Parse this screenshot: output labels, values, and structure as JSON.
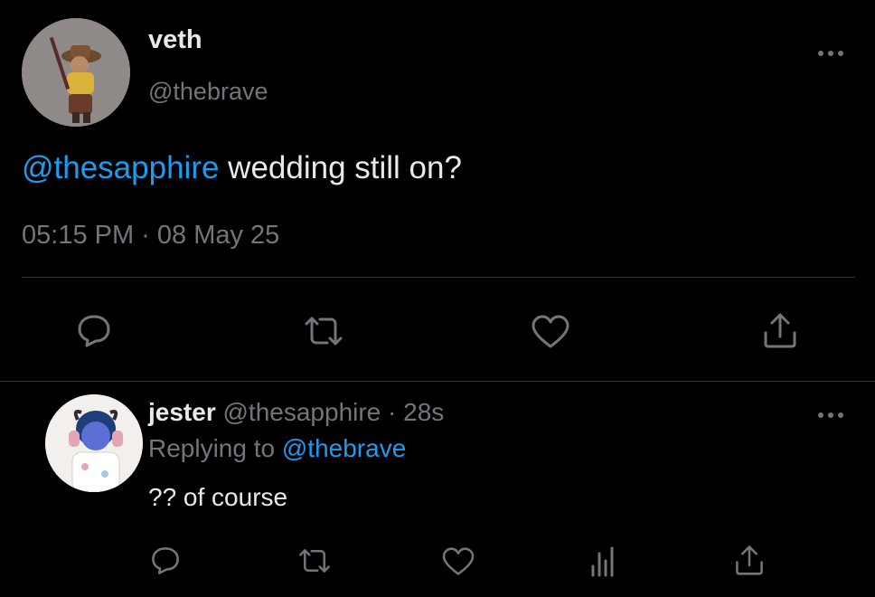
{
  "main_tweet": {
    "display_name": "veth",
    "handle": "@thebrave",
    "mention": "@thesapphire",
    "text": " wedding still on?",
    "timestamp": "05:15 PM · 08 May 25",
    "more_icon": "more-horizontal-icon",
    "actions": [
      "reply-icon",
      "retweet-icon",
      "like-icon",
      "share-icon"
    ]
  },
  "reply_tweet": {
    "display_name": "jester",
    "handle": "@thesapphire",
    "age": "· 28s",
    "replying_prefix": "Replying to ",
    "replying_handle": "@thebrave",
    "text": "?? of course",
    "more_icon": "more-horizontal-icon",
    "actions": [
      "reply-icon",
      "retweet-icon",
      "like-icon",
      "analytics-icon",
      "share-icon"
    ]
  },
  "colors": {
    "background": "#000000",
    "text": "#e7e9ea",
    "muted": "#71767b",
    "link": "#1d9bf0",
    "divider": "#2f3336"
  }
}
